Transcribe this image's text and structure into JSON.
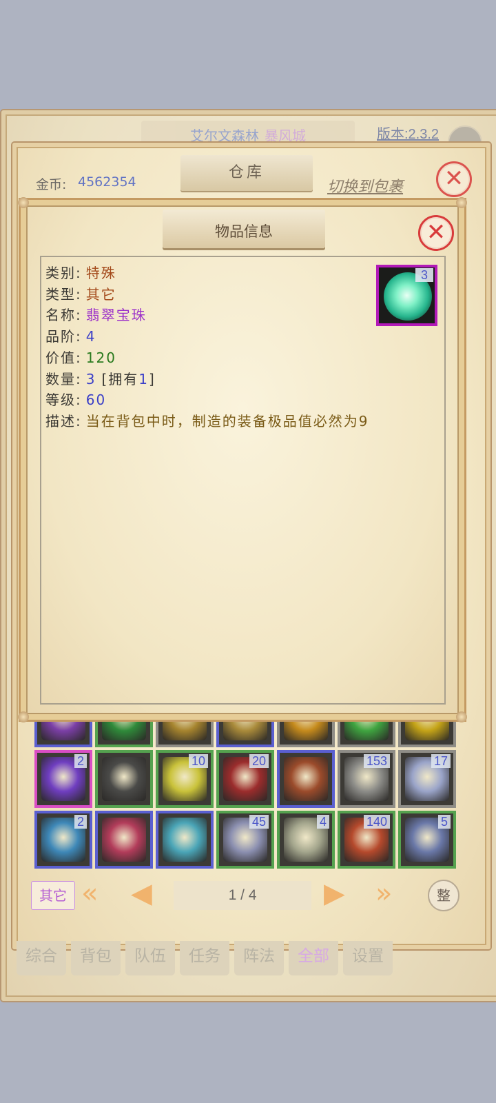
{
  "background": {
    "location_main": "艾尔文森林",
    "location_sub": "暴风城",
    "version": "版本:2.3.2",
    "bottom_tabs": [
      "综合",
      "背包",
      "队伍",
      "任务",
      "阵法",
      "全部",
      "设置"
    ],
    "active_tab_index": 5
  },
  "warehouse": {
    "title": "仓库",
    "gold_label": "金币:",
    "gold_value": "4562354",
    "switch_link": "切换到包裹",
    "close_icon": "close-icon",
    "grid_rows": [
      [
        {
          "color": "blue",
          "art": "#7b3fa6",
          "count": ""
        },
        {
          "color": "green",
          "art": "#2f8a3a",
          "count": ""
        },
        {
          "color": "gray",
          "art": "#a6842e",
          "count": ""
        },
        {
          "color": "blue",
          "art": "#a98a3a",
          "count": ""
        },
        {
          "color": "gray",
          "art": "#c58a1c",
          "count": ""
        },
        {
          "color": "gray",
          "art": "#3fa440",
          "count": ""
        },
        {
          "color": "gray",
          "art": "#c4a317",
          "count": ""
        }
      ],
      [
        {
          "color": "pink",
          "art": "#6f3ec0",
          "count": "2"
        },
        {
          "color": "green",
          "art": "#4a4a48",
          "count": ""
        },
        {
          "color": "green",
          "art": "#c9c23a",
          "count": "10"
        },
        {
          "color": "green",
          "art": "#9b2c2c",
          "count": "20"
        },
        {
          "color": "blue",
          "art": "#9b4b2b",
          "count": ""
        },
        {
          "color": "gray",
          "art": "#8c8c88",
          "count": "153"
        },
        {
          "color": "gray",
          "art": "#9aa4c9",
          "count": "17"
        }
      ],
      [
        {
          "color": "blue",
          "art": "#3e88b8",
          "count": "2"
        },
        {
          "color": "blue",
          "art": "#b23c5a",
          "count": ""
        },
        {
          "color": "blue",
          "art": "#4aa5b7",
          "count": ""
        },
        {
          "color": "green",
          "art": "#8b8fb0",
          "count": "45"
        },
        {
          "color": "green",
          "art": "#a3a58c",
          "count": "4"
        },
        {
          "color": "green",
          "art": "#b5492c",
          "count": "140"
        },
        {
          "color": "green",
          "art": "#6a78a8",
          "count": "5"
        }
      ]
    ],
    "filter_button": "其它",
    "page_text": "1 / 4",
    "sort_button": "整",
    "first_page_icon": "double-left-arrow-icon",
    "prev_page_icon": "left-arrow-icon",
    "next_page_icon": "right-arrow-icon",
    "last_page_icon": "double-right-arrow-icon"
  },
  "item_info": {
    "title": "物品信息",
    "close_icon": "close-icon",
    "icon_count": "3",
    "icon_name": "green-orb-icon",
    "attributes": [
      {
        "label": "类别:",
        "value": "特殊",
        "color": "#a3491a"
      },
      {
        "label": "类型:",
        "value": "其它",
        "color": "#a3491a"
      },
      {
        "label": "名称:",
        "value": "翡翠宝珠",
        "color": "#9b2fc9"
      },
      {
        "label": "品阶:",
        "value": "4",
        "color": "#3b3fc8"
      },
      {
        "label": "价值:",
        "value": "120",
        "color": "#2a7a1e"
      },
      {
        "label": "数量:",
        "value": "3",
        "color": "#3b3fc8",
        "extra_open": "[拥有",
        "extra_num": "1",
        "extra_close": "]"
      },
      {
        "label": "等级:",
        "value": "60",
        "color": "#3b3fc8"
      },
      {
        "label": "描述:",
        "value": "当在背包中时，制造的装备极品值必然为9",
        "color": "#7a5b17"
      }
    ]
  }
}
